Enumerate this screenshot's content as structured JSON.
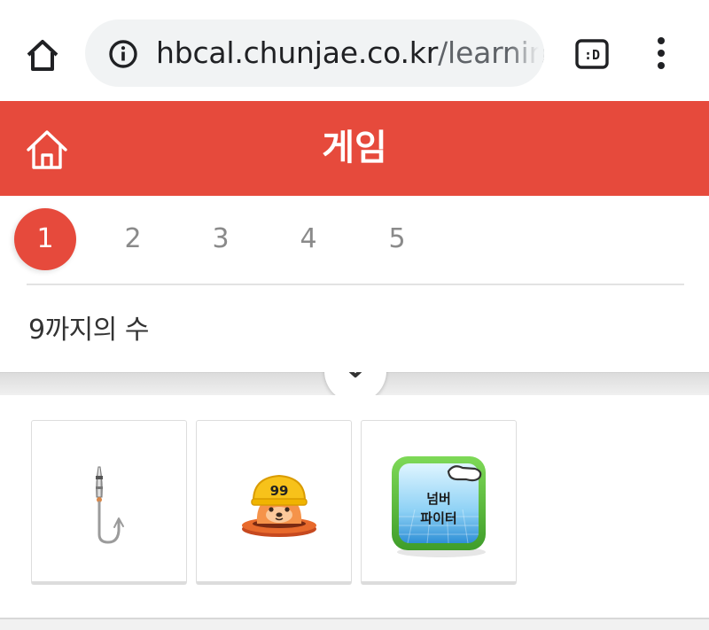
{
  "browser": {
    "url_host": "hbcal.chunjae.co.kr",
    "url_path": "/learning",
    "home_icon": "home-icon",
    "info_icon": "info-icon",
    "tabs_icon": "tab-switcher-icon",
    "tabs_label": ":D",
    "menu_icon": "more-vert-icon"
  },
  "header": {
    "title": "게임",
    "home_icon": "home-outline-icon",
    "background": "#e64a3c"
  },
  "chapters": {
    "items": [
      "1",
      "2",
      "3",
      "4",
      "5"
    ],
    "active_index": 0,
    "active_color": "#e64a3c"
  },
  "section": {
    "title": "9까지의 수",
    "toggle_icon": "chevron-down-icon"
  },
  "games": [
    {
      "icon": "fishing-hook-icon"
    },
    {
      "icon": "mole-helmet-icon",
      "badge": "99"
    },
    {
      "icon": "number-fighter-icon",
      "line1": "넘버",
      "line2": "파이터"
    }
  ]
}
